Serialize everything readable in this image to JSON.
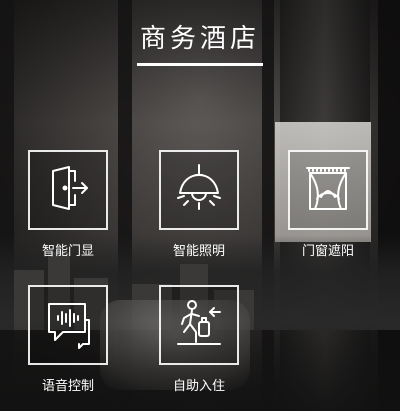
{
  "header": {
    "title": "商务酒店"
  },
  "tiles": [
    {
      "label": "智能门显",
      "icon": "door-exit-icon"
    },
    {
      "label": "智能照明",
      "icon": "ceiling-lamp-icon"
    },
    {
      "label": "门窗遮阳",
      "icon": "curtain-window-icon"
    },
    {
      "label": "语音控制",
      "icon": "voice-chat-icon"
    },
    {
      "label": "自助入住",
      "icon": "self-checkin-icon"
    }
  ],
  "colors": {
    "text": "#ffffff",
    "tile_border": "#ffffff"
  }
}
